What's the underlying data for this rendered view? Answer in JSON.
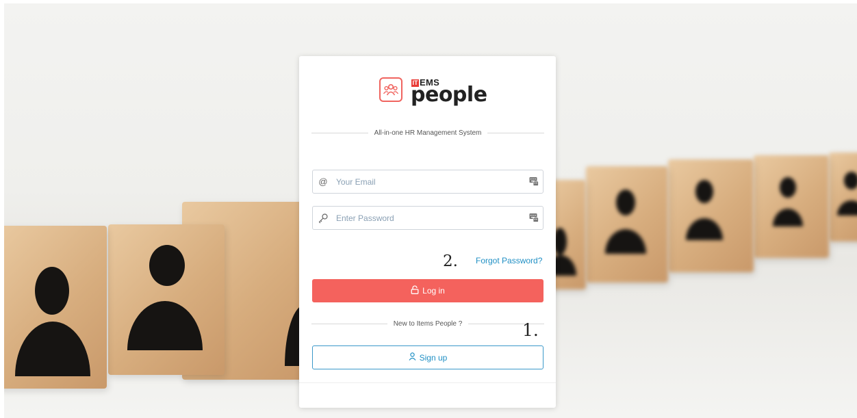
{
  "brand": {
    "logo_it": "IT",
    "logo_ems": "EMS",
    "logo_word": "people",
    "tagline": "All-in-one HR Management System",
    "accent_color": "#f4625d",
    "link_color": "#1f8fc4"
  },
  "form": {
    "email_placeholder": "Your Email",
    "email_value": "",
    "password_placeholder": "Enter Password",
    "password_value": "",
    "forgot_label": "Forgot Password?",
    "login_label": "Log in",
    "new_user_text": "New to Items People ?",
    "signup_label": "Sign up"
  },
  "annotations": {
    "step1": "1.",
    "step2": "2."
  },
  "icons": {
    "email_leading": "at-icon",
    "password_leading": "key-icon",
    "field_trailing": "keyboard-icon",
    "login": "lock-icon",
    "signup": "user-icon",
    "logo": "people-group-icon"
  }
}
